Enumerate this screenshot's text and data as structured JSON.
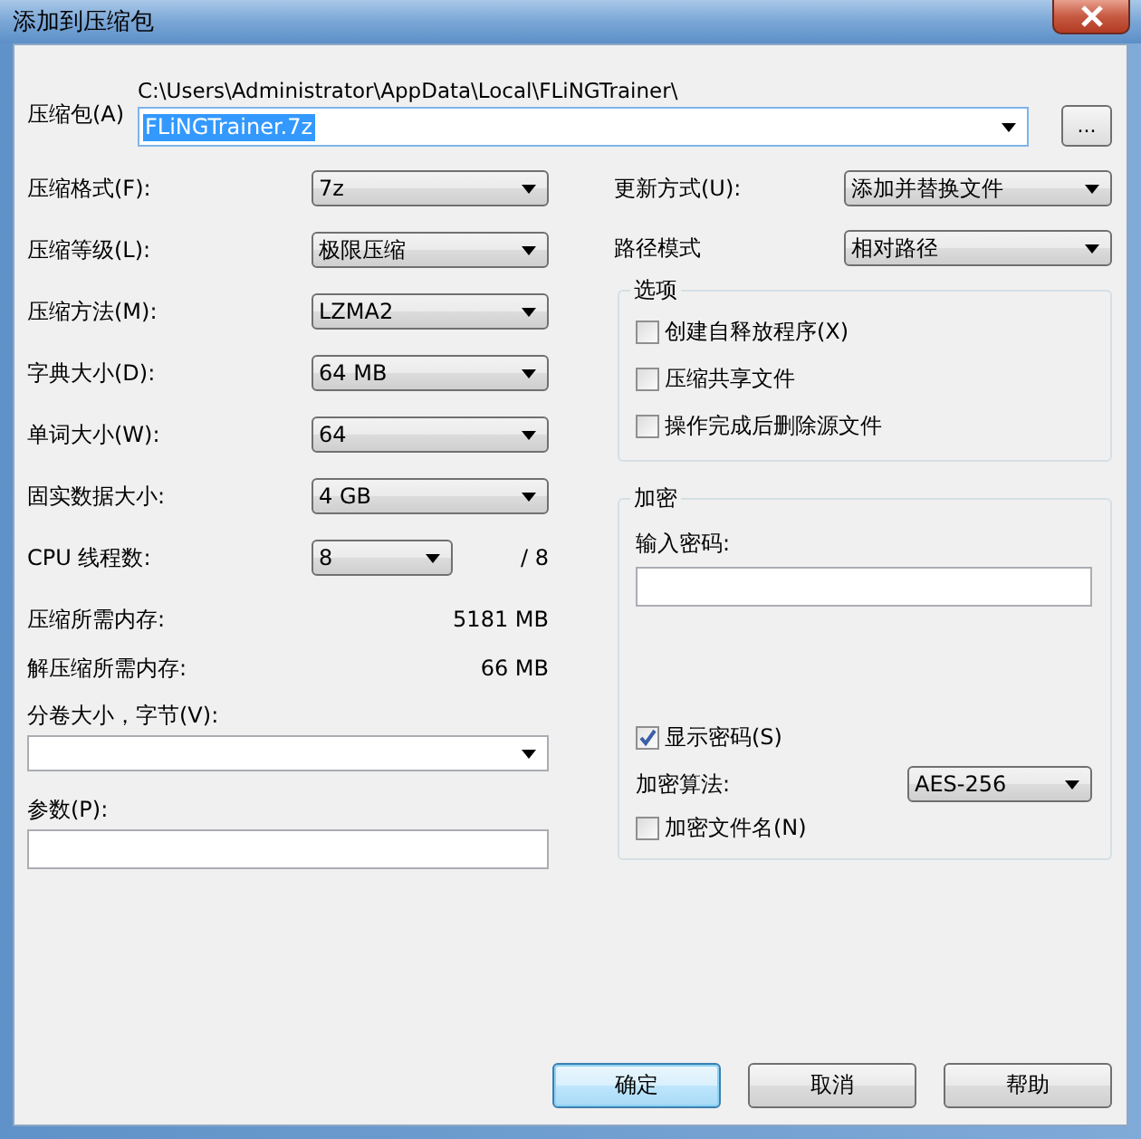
{
  "window": {
    "title": "添加到压缩包"
  },
  "archive": {
    "label": "压缩包(A)",
    "path": "C:\\Users\\Administrator\\AppData\\Local\\FLiNGTrainer\\",
    "filename": "FLiNGTrainer.7z",
    "highlighted": true,
    "browse": "..."
  },
  "settings": [
    {
      "kind": "select",
      "label": "压缩格式(F):",
      "value": "7z"
    },
    {
      "kind": "select",
      "label": "压缩等级(L):",
      "value": "极限压缩"
    },
    {
      "kind": "select",
      "label": "压缩方法(M):",
      "value": "LZMA2"
    },
    {
      "kind": "select",
      "label": "字典大小(D):",
      "value": "64 MB"
    },
    {
      "kind": "select",
      "label": "单词大小(W):",
      "value": "64"
    },
    {
      "kind": "select",
      "label": "固实数据大小:",
      "value": "4 GB"
    },
    {
      "kind": "threads",
      "label": "CPU 线程数:",
      "value": "8",
      "max": "/ 8"
    },
    {
      "kind": "info",
      "label": "压缩所需内存:",
      "value": "5181 MB"
    },
    {
      "kind": "info",
      "label": "解压缩所需内存:",
      "value": "66 MB"
    }
  ],
  "volume": {
    "label": "分卷大小，字节(V):"
  },
  "parameters": {
    "label": "参数(P):"
  },
  "update": {
    "label": "更新方式(U):",
    "value": "添加并替换文件"
  },
  "path_mode": {
    "label": "路径模式",
    "value": "相对路径"
  },
  "options": {
    "title": "选项",
    "items": [
      {
        "label": "创建自释放程序(X)",
        "checked": false
      },
      {
        "label": "压缩共享文件",
        "checked": false
      },
      {
        "label": "操作完成后删除源文件",
        "checked": false
      }
    ]
  },
  "encryption": {
    "title": "加密",
    "password_label": "输入密码:",
    "show_password": {
      "label": "显示密码(S)",
      "checked": true
    },
    "method_label": "加密算法:",
    "method": "AES-256",
    "encrypt_names": {
      "label": "加密文件名(N)",
      "checked": false
    }
  },
  "buttons": [
    {
      "label": "确定",
      "default": true
    },
    {
      "label": "取消",
      "default": false
    },
    {
      "label": "帮助",
      "default": false
    }
  ]
}
